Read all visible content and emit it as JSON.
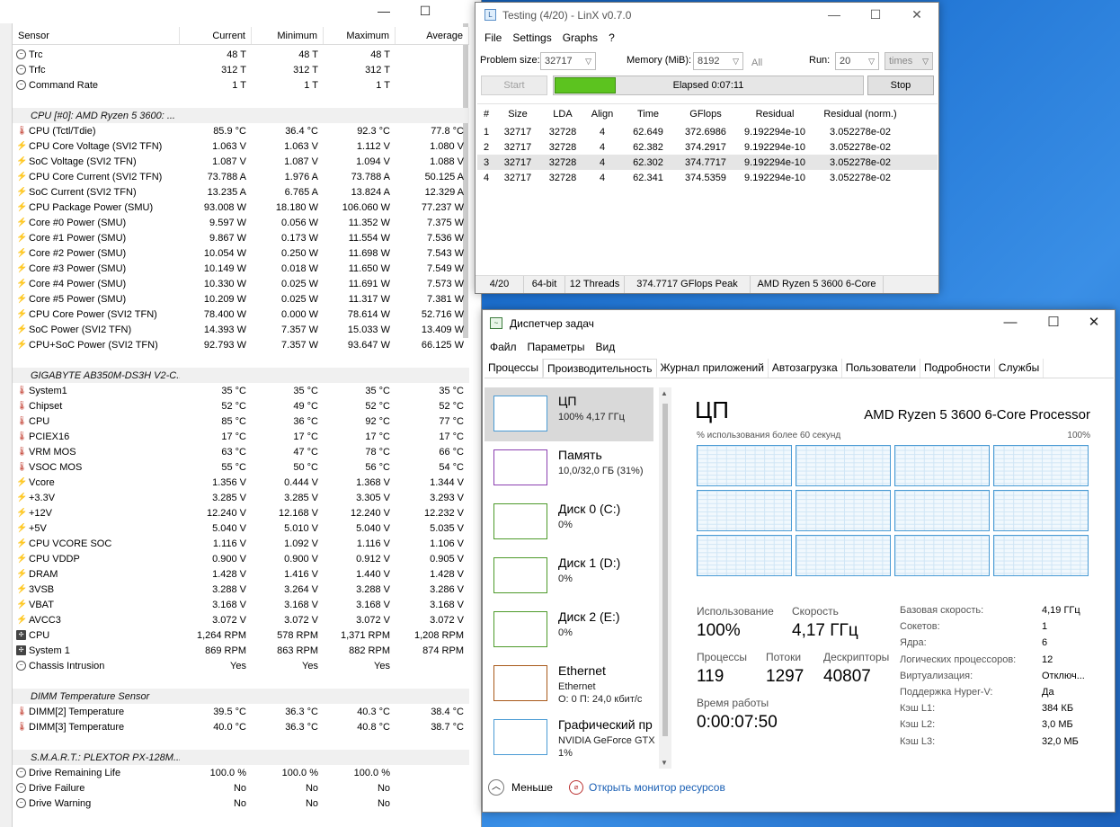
{
  "hwinfo": {
    "window_controls": [
      "—",
      "☐"
    ],
    "columns": [
      "Sensor",
      "Current",
      "Minimum",
      "Maximum",
      "Average"
    ],
    "rows": [
      {
        "icon": "clock",
        "name": "Trc",
        "cur": "48 T",
        "min": "48 T",
        "max": "48 T",
        "avg": ""
      },
      {
        "icon": "clock",
        "name": "Trfc",
        "cur": "312 T",
        "min": "312 T",
        "max": "312 T",
        "avg": ""
      },
      {
        "icon": "clock",
        "name": "Command Rate",
        "cur": "1 T",
        "min": "1 T",
        "max": "1 T",
        "avg": ""
      },
      {
        "type": "blank"
      },
      {
        "type": "group",
        "name": "CPU [#0]: AMD Ryzen 5 3600: ..."
      },
      {
        "icon": "therm",
        "name": "CPU (Tctl/Tdie)",
        "cur": "85.9 °C",
        "min": "36.4 °C",
        "max": "92.3 °C",
        "avg": "77.8 °C"
      },
      {
        "icon": "volt",
        "name": "CPU Core Voltage (SVI2 TFN)",
        "cur": "1.063 V",
        "min": "1.063 V",
        "max": "1.112 V",
        "avg": "1.080 V"
      },
      {
        "icon": "volt",
        "name": "SoC Voltage (SVI2 TFN)",
        "cur": "1.087 V",
        "min": "1.087 V",
        "max": "1.094 V",
        "avg": "1.088 V"
      },
      {
        "icon": "volt",
        "name": "CPU Core Current (SVI2 TFN)",
        "cur": "73.788 A",
        "min": "1.976 A",
        "max": "73.788 A",
        "avg": "50.125 A"
      },
      {
        "icon": "volt",
        "name": "SoC Current (SVI2 TFN)",
        "cur": "13.235 A",
        "min": "6.765 A",
        "max": "13.824 A",
        "avg": "12.329 A"
      },
      {
        "icon": "volt",
        "name": "CPU Package Power (SMU)",
        "cur": "93.008 W",
        "min": "18.180 W",
        "max": "106.060 W",
        "avg": "77.237 W"
      },
      {
        "icon": "volt",
        "name": "Core #0 Power (SMU)",
        "cur": "9.597 W",
        "min": "0.056 W",
        "max": "11.352 W",
        "avg": "7.375 W"
      },
      {
        "icon": "volt",
        "name": "Core #1 Power (SMU)",
        "cur": "9.867 W",
        "min": "0.173 W",
        "max": "11.554 W",
        "avg": "7.536 W"
      },
      {
        "icon": "volt",
        "name": "Core #2 Power (SMU)",
        "cur": "10.054 W",
        "min": "0.250 W",
        "max": "11.698 W",
        "avg": "7.543 W"
      },
      {
        "icon": "volt",
        "name": "Core #3 Power (SMU)",
        "cur": "10.149 W",
        "min": "0.018 W",
        "max": "11.650 W",
        "avg": "7.549 W"
      },
      {
        "icon": "volt",
        "name": "Core #4 Power (SMU)",
        "cur": "10.330 W",
        "min": "0.025 W",
        "max": "11.691 W",
        "avg": "7.573 W"
      },
      {
        "icon": "volt",
        "name": "Core #5 Power (SMU)",
        "cur": "10.209 W",
        "min": "0.025 W",
        "max": "11.317 W",
        "avg": "7.381 W"
      },
      {
        "icon": "volt",
        "name": "CPU Core Power (SVI2 TFN)",
        "cur": "78.400 W",
        "min": "0.000 W",
        "max": "78.614 W",
        "avg": "52.716 W"
      },
      {
        "icon": "volt",
        "name": "SoC Power (SVI2 TFN)",
        "cur": "14.393 W",
        "min": "7.357 W",
        "max": "15.033 W",
        "avg": "13.409 W"
      },
      {
        "icon": "volt",
        "name": "CPU+SoC Power (SVI2 TFN)",
        "cur": "92.793 W",
        "min": "7.357 W",
        "max": "93.647 W",
        "avg": "66.125 W"
      },
      {
        "type": "blank"
      },
      {
        "type": "group",
        "name": "GIGABYTE AB350M-DS3H V2-C..."
      },
      {
        "icon": "therm",
        "name": "System1",
        "cur": "35 °C",
        "min": "35 °C",
        "max": "35 °C",
        "avg": "35 °C"
      },
      {
        "icon": "therm",
        "name": "Chipset",
        "cur": "52 °C",
        "min": "49 °C",
        "max": "52 °C",
        "avg": "52 °C"
      },
      {
        "icon": "therm",
        "name": "CPU",
        "cur": "85 °C",
        "min": "36 °C",
        "max": "92 °C",
        "avg": "77 °C"
      },
      {
        "icon": "therm",
        "name": "PCIEX16",
        "cur": "17 °C",
        "min": "17 °C",
        "max": "17 °C",
        "avg": "17 °C"
      },
      {
        "icon": "therm",
        "name": "VRM MOS",
        "cur": "63 °C",
        "min": "47 °C",
        "max": "78 °C",
        "avg": "66 °C"
      },
      {
        "icon": "therm",
        "name": "VSOC MOS",
        "cur": "55 °C",
        "min": "50 °C",
        "max": "56 °C",
        "avg": "54 °C"
      },
      {
        "icon": "volt",
        "name": "Vcore",
        "cur": "1.356 V",
        "min": "0.444 V",
        "max": "1.368 V",
        "avg": "1.344 V"
      },
      {
        "icon": "volt",
        "name": "+3.3V",
        "cur": "3.285 V",
        "min": "3.285 V",
        "max": "3.305 V",
        "avg": "3.293 V"
      },
      {
        "icon": "volt",
        "name": "+12V",
        "cur": "12.240 V",
        "min": "12.168 V",
        "max": "12.240 V",
        "avg": "12.232 V"
      },
      {
        "icon": "volt",
        "name": "+5V",
        "cur": "5.040 V",
        "min": "5.010 V",
        "max": "5.040 V",
        "avg": "5.035 V"
      },
      {
        "icon": "volt",
        "name": "CPU VCORE SOC",
        "cur": "1.116 V",
        "min": "1.092 V",
        "max": "1.116 V",
        "avg": "1.106 V"
      },
      {
        "icon": "volt",
        "name": "CPU VDDP",
        "cur": "0.900 V",
        "min": "0.900 V",
        "max": "0.912 V",
        "avg": "0.905 V"
      },
      {
        "icon": "volt",
        "name": "DRAM",
        "cur": "1.428 V",
        "min": "1.416 V",
        "max": "1.440 V",
        "avg": "1.428 V"
      },
      {
        "icon": "volt",
        "name": "3VSB",
        "cur": "3.288 V",
        "min": "3.264 V",
        "max": "3.288 V",
        "avg": "3.286 V"
      },
      {
        "icon": "volt",
        "name": "VBAT",
        "cur": "3.168 V",
        "min": "3.168 V",
        "max": "3.168 V",
        "avg": "3.168 V"
      },
      {
        "icon": "volt",
        "name": "AVCC3",
        "cur": "3.072 V",
        "min": "3.072 V",
        "max": "3.072 V",
        "avg": "3.072 V"
      },
      {
        "icon": "fan",
        "name": "CPU",
        "cur": "1,264 RPM",
        "min": "578 RPM",
        "max": "1,371 RPM",
        "avg": "1,208 RPM"
      },
      {
        "icon": "fan",
        "name": "System 1",
        "cur": "869 RPM",
        "min": "863 RPM",
        "max": "882 RPM",
        "avg": "874 RPM"
      },
      {
        "icon": "clock",
        "name": "Chassis Intrusion",
        "cur": "Yes",
        "min": "Yes",
        "max": "Yes",
        "avg": ""
      },
      {
        "type": "blank"
      },
      {
        "type": "group",
        "name": "DIMM Temperature Sensor"
      },
      {
        "icon": "therm",
        "name": "DIMM[2] Temperature",
        "cur": "39.5 °C",
        "min": "36.3 °C",
        "max": "40.3 °C",
        "avg": "38.4 °C"
      },
      {
        "icon": "therm",
        "name": "DIMM[3] Temperature",
        "cur": "40.0 °C",
        "min": "36.3 °C",
        "max": "40.8 °C",
        "avg": "38.7 °C"
      },
      {
        "type": "blank"
      },
      {
        "type": "group",
        "name": "S.M.A.R.T.: PLEXTOR PX-128M..."
      },
      {
        "icon": "clock",
        "name": "Drive Remaining Life",
        "cur": "100.0 %",
        "min": "100.0 %",
        "max": "100.0 %",
        "avg": ""
      },
      {
        "icon": "clock",
        "name": "Drive Failure",
        "cur": "No",
        "min": "No",
        "max": "No",
        "avg": ""
      },
      {
        "icon": "clock",
        "name": "Drive Warning",
        "cur": "No",
        "min": "No",
        "max": "No",
        "avg": ""
      }
    ]
  },
  "linx": {
    "title": "Testing (4/20) - LinX v0.7.0",
    "window_controls": [
      "—",
      "☐",
      "✕"
    ],
    "menu": [
      "File",
      "Settings",
      "Graphs",
      "?"
    ],
    "problem_size_label": "Problem size:",
    "problem_size_value": "32717",
    "memory_label": "Memory (MiB):",
    "memory_value": "8192",
    "all_label": "All",
    "run_label": "Run:",
    "run_value": "20",
    "times_value": "times",
    "start_label": "Start",
    "stop_label": "Stop",
    "elapsed": "Elapsed 0:07:11",
    "progress": 0.2,
    "columns": [
      "#",
      "Size",
      "LDA",
      "Align",
      "Time",
      "GFlops",
      "Residual",
      "Residual (norm.)"
    ],
    "results": [
      [
        "1",
        "32717",
        "32728",
        "4",
        "62.649",
        "372.6986",
        "9.192294e-10",
        "3.052278e-02"
      ],
      [
        "2",
        "32717",
        "32728",
        "4",
        "62.382",
        "374.2917",
        "9.192294e-10",
        "3.052278e-02"
      ],
      [
        "3",
        "32717",
        "32728",
        "4",
        "62.302",
        "374.7717",
        "9.192294e-10",
        "3.052278e-02"
      ],
      [
        "4",
        "32717",
        "32728",
        "4",
        "62.341",
        "374.5359",
        "9.192294e-10",
        "3.052278e-02"
      ]
    ],
    "selected_row": 2,
    "status": [
      "4/20",
      "64-bit",
      "12 Threads",
      "374.7717 GFlops Peak",
      "AMD Ryzen 5 3600 6-Core"
    ]
  },
  "taskmgr": {
    "title": "Диспетчер задач",
    "window_controls": [
      "—",
      "☐",
      "✕"
    ],
    "menu": [
      "Файл",
      "Параметры",
      "Вид"
    ],
    "tabs": [
      "Процессы",
      "Производительность",
      "Журнал приложений",
      "Автозагрузка",
      "Пользователи",
      "Подробности",
      "Службы"
    ],
    "active_tab": 1,
    "items": [
      {
        "name": "ЦП",
        "sub": "100% 4,17 ГГц",
        "sub2": "",
        "color": "#4a9bd4",
        "active": true
      },
      {
        "name": "Память",
        "sub": "10,0/32,0 ГБ (31%)",
        "sub2": "",
        "color": "#8b3fb0",
        "active": false
      },
      {
        "name": "Диск 0 (C:)",
        "sub": "0%",
        "sub2": "",
        "color": "#4d9a2a",
        "active": false
      },
      {
        "name": "Диск 1 (D:)",
        "sub": "0%",
        "sub2": "",
        "color": "#4d9a2a",
        "active": false
      },
      {
        "name": "Диск 2 (E:)",
        "sub": "0%",
        "sub2": "",
        "color": "#4d9a2a",
        "active": false
      },
      {
        "name": "Ethernet",
        "sub": "Ethernet",
        "sub2": "О: 0 П: 24,0 кбит/с",
        "color": "#a8591a",
        "active": false
      },
      {
        "name": "Графический пр",
        "sub": "NVIDIA GeForce GTX",
        "sub2": "1%",
        "color": "#4a9bd4",
        "active": false
      }
    ],
    "cpu_title": "ЦП",
    "cpu_model": "AMD Ryzen 5 3600 6-Core Processor",
    "graph_label": "% использования более 60 секунд",
    "graph_max": "100%",
    "usage_label": "Использование",
    "usage_value": "100%",
    "speed_label": "Скорость",
    "speed_value": "4,17 ГГц",
    "processes_label": "Процессы",
    "processes_value": "119",
    "threads_label": "Потоки",
    "threads_value": "1297",
    "handles_label": "Дескрипторы",
    "handles_value": "40807",
    "uptime_label": "Время работы",
    "uptime_value": "0:00:07:50",
    "specs": [
      [
        "Базовая скорость:",
        "4,19 ГГц"
      ],
      [
        "Сокетов:",
        "1"
      ],
      [
        "Ядра:",
        "6"
      ],
      [
        "Логических процессоров:",
        "12"
      ],
      [
        "Виртуализация:",
        "Отключ..."
      ],
      [
        "Поддержка Hyper-V:",
        "Да"
      ],
      [
        "Кэш L1:",
        "384 КБ"
      ],
      [
        "Кэш L2:",
        "3,0 МБ"
      ],
      [
        "Кэш L3:",
        "32,0 МБ"
      ]
    ],
    "less_label": "Меньше",
    "monitor_link": "Открыть монитор ресурсов"
  }
}
